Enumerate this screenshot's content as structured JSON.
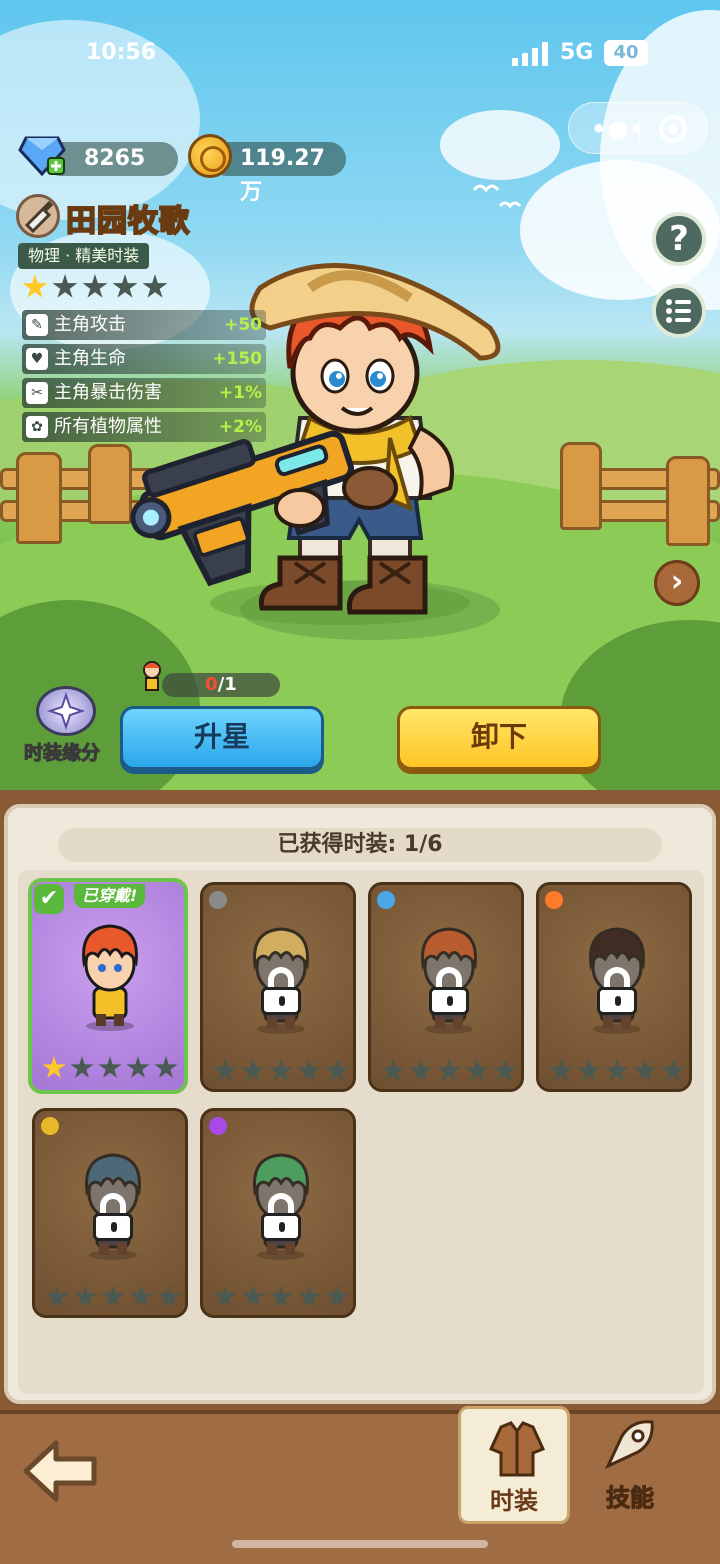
{
  "status_bar": {
    "time": "10:56",
    "network": "5G",
    "battery": "40"
  },
  "currency": {
    "gems": "8265",
    "coins": "119.27万"
  },
  "costume": {
    "name": "田园牧歌",
    "subtitle": "物理 · 精美时装",
    "star_level": 1,
    "max_stars": 5,
    "stats": [
      {
        "label": "主角攻击",
        "value": "+50",
        "icon": "sword-icon"
      },
      {
        "label": "主角生命",
        "value": "+150",
        "icon": "heart-icon"
      },
      {
        "label": "主角暴击伤害",
        "value": "+1%",
        "icon": "crit-icon"
      },
      {
        "label": "所有植物属性",
        "value": "+2%",
        "icon": "plant-icon"
      }
    ]
  },
  "star_progress": {
    "current": "0",
    "total": "/1"
  },
  "fate": {
    "label": "时装缘分"
  },
  "actions": {
    "upgrade_star": "升星",
    "unequip": "卸下"
  },
  "collection": {
    "header": "已获得时装: 1/6"
  },
  "cards": [
    {
      "state": "equipped",
      "badge": "已穿戴!",
      "stars": 1,
      "element": "none",
      "hair": "#e8582a"
    },
    {
      "state": "locked",
      "stars": 0,
      "element": "stone",
      "hair": "#e8c66a"
    },
    {
      "state": "locked",
      "stars": 0,
      "element": "water",
      "hair": "#c85a2a"
    },
    {
      "state": "locked",
      "stars": 0,
      "element": "fire",
      "hair": "#2a1a1a"
    },
    {
      "state": "locked",
      "stars": 0,
      "element": "lightning",
      "hair": "#3a6a8a"
    },
    {
      "state": "locked",
      "stars": 0,
      "element": "poison",
      "hair": "#3ab06a"
    }
  ],
  "tabs": [
    {
      "label": "时装",
      "icon": "costume-icon",
      "active": true
    },
    {
      "label": "技能",
      "icon": "skill-icon",
      "active": false
    }
  ],
  "colors": {
    "accent_blue": "#2aa6ea",
    "accent_yellow": "#ffc524",
    "stat_value": "#b8f04a",
    "equipped_green": "#5ab83a"
  }
}
